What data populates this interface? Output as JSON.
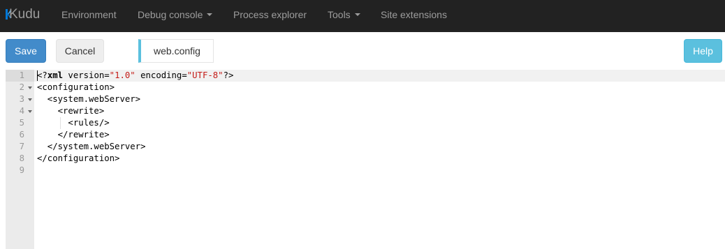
{
  "navbar": {
    "brand": "Kudu",
    "brand_accent_color": "#0078d7",
    "items": [
      {
        "label": "Environment",
        "dropdown": false
      },
      {
        "label": "Debug console",
        "dropdown": true
      },
      {
        "label": "Process explorer",
        "dropdown": false
      },
      {
        "label": "Tools",
        "dropdown": true
      },
      {
        "label": "Site extensions",
        "dropdown": false
      }
    ]
  },
  "toolbar": {
    "save_label": "Save",
    "cancel_label": "Cancel",
    "file_name": "web.config",
    "help_label": "Help"
  },
  "editor": {
    "line_numbers": [
      "1",
      "2",
      "3",
      "4",
      "5",
      "6",
      "7",
      "8",
      "9"
    ],
    "lines": [
      {
        "parts": [
          "<?",
          "xml",
          " version=",
          "\"1.0\"",
          " encoding=",
          "\"UTF-8\"",
          "?>"
        ]
      },
      {
        "text": "<configuration>"
      },
      {
        "text": "  <system.webServer>"
      },
      {
        "text": "    <rewrite>"
      },
      {
        "text": "      <rules/>"
      },
      {
        "text": "    </rewrite>"
      },
      {
        "text": "  </system.webServer>"
      },
      {
        "text": "</configuration>"
      },
      {
        "text": ""
      }
    ]
  }
}
